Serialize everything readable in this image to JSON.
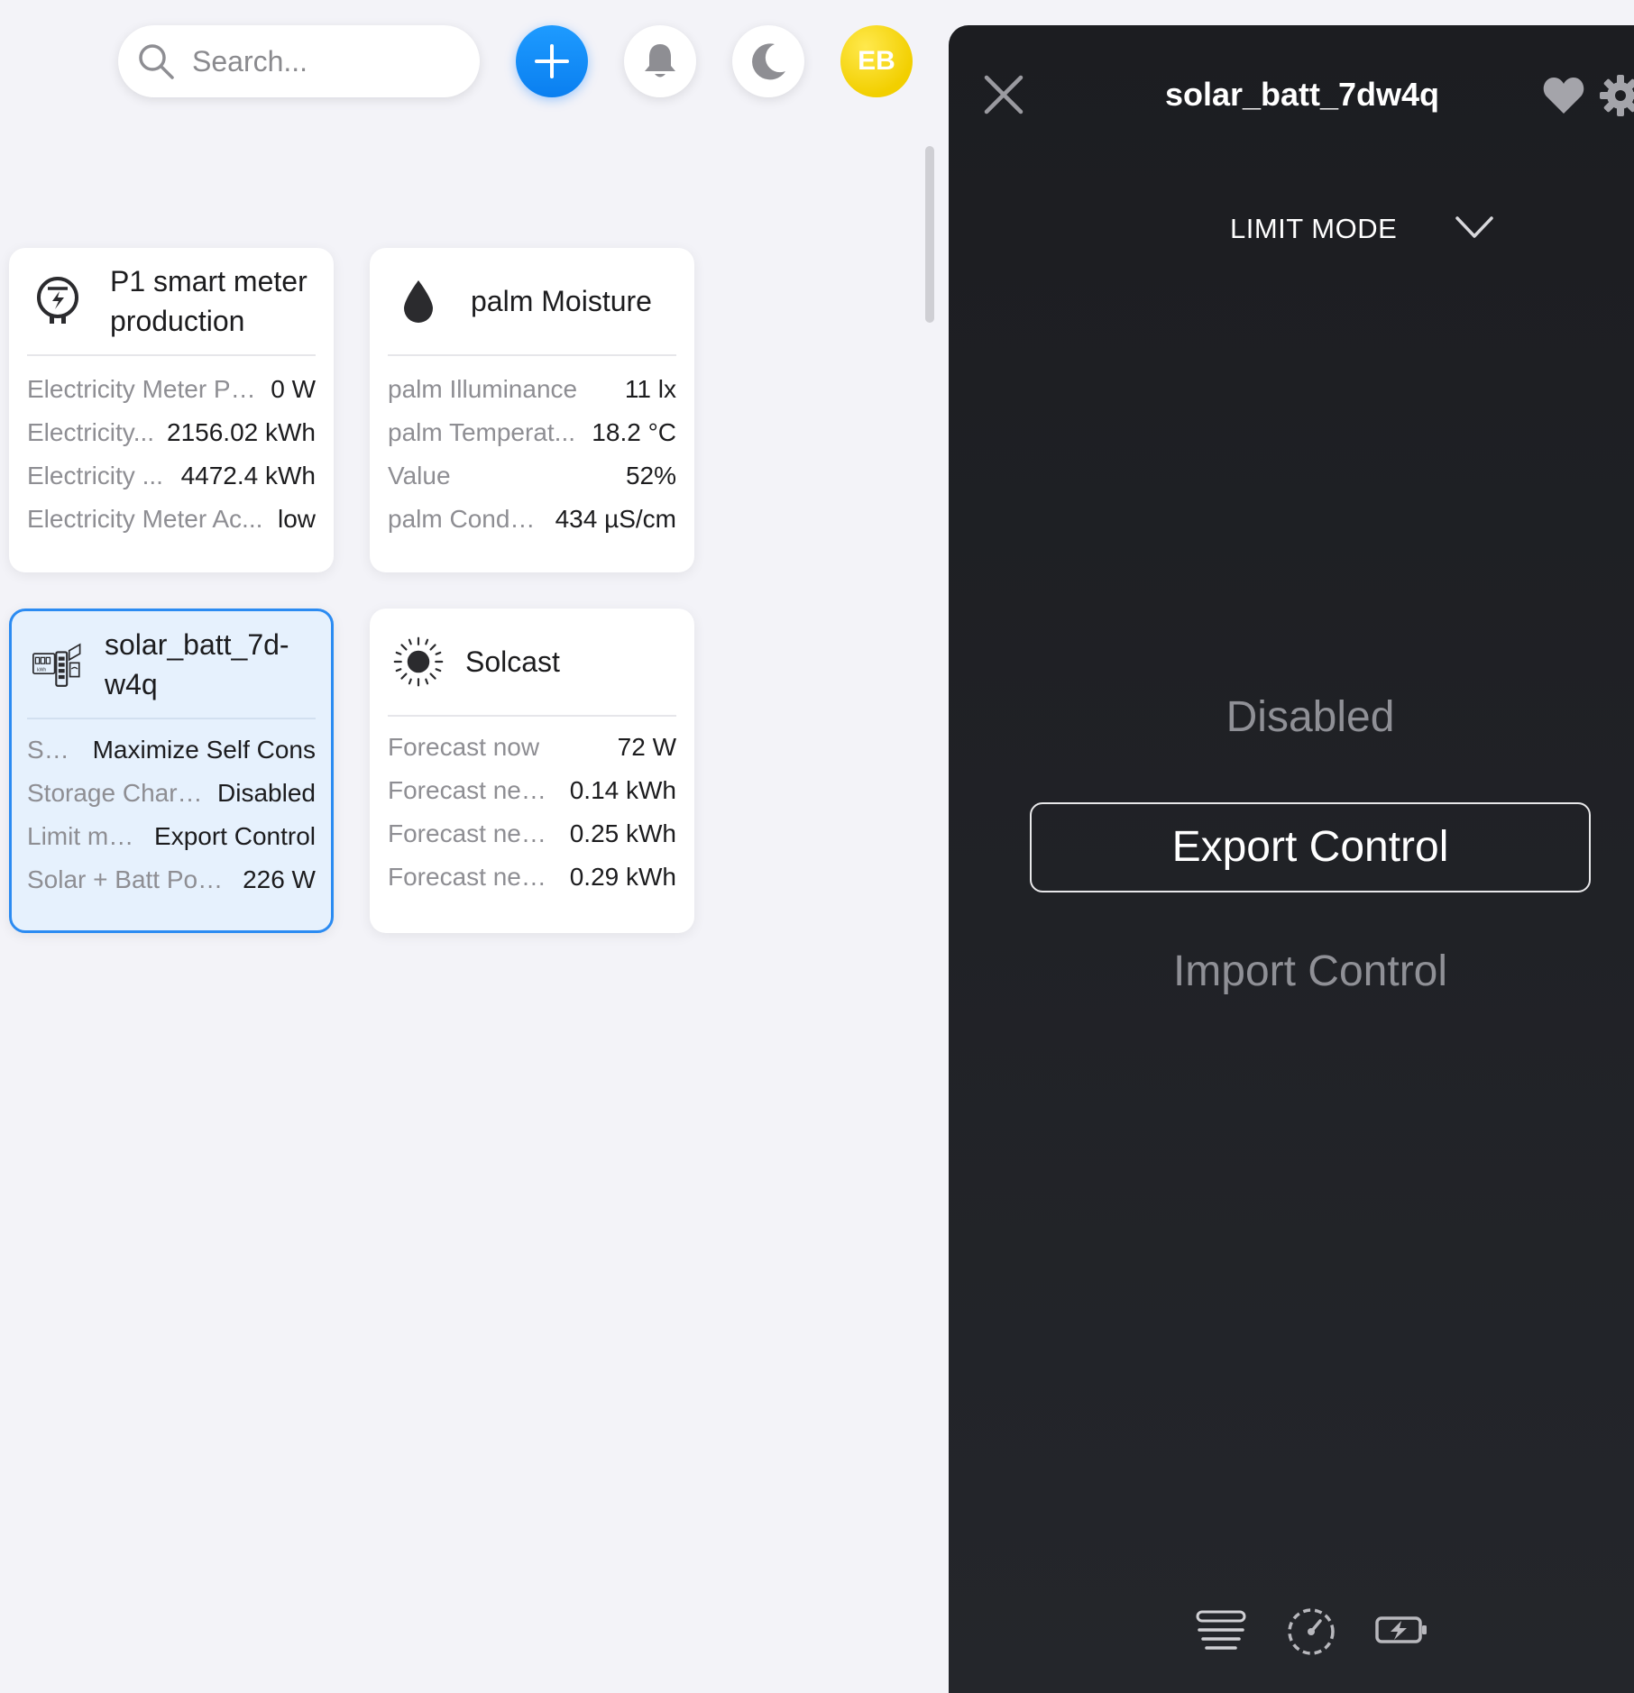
{
  "search": {
    "placeholder": "Search..."
  },
  "header": {
    "avatar_initials": "EB"
  },
  "colors": {
    "accent": "#0a84ff",
    "avatar": "#f2cf00",
    "panel_bg": "#1c1d21"
  },
  "cards": [
    {
      "title": "P1 smart meter production",
      "icon": "electricity-meter-icon",
      "rows": [
        {
          "label": "Electricity Meter Po...",
          "value": "0 W"
        },
        {
          "label": "Electricity...",
          "value": "2156.02 kWh"
        },
        {
          "label": "Electricity ...",
          "value": "4472.4 kWh"
        },
        {
          "label": "Electricity Meter Ac...",
          "value": "low"
        }
      ]
    },
    {
      "title": "palm Moisture",
      "icon": "water-drop-icon",
      "rows": [
        {
          "label": "palm Illuminance",
          "value": "11 lx"
        },
        {
          "label": "palm Temperat...",
          "value": "18.2 °C"
        },
        {
          "label": "Value",
          "value": "52%"
        },
        {
          "label": "palm Condu...",
          "value": "434 µS/cm"
        }
      ]
    },
    {
      "title_line1": "solar_batt_7d-",
      "title_line2": "w4q",
      "icon": "solar-battery-icon",
      "rows": [
        {
          "label": "Stor...",
          "value": "Maximize Self Cons"
        },
        {
          "label": "Storage Charg...",
          "value": "Disabled"
        },
        {
          "label": "Limit mo...",
          "value": "Export Control"
        },
        {
          "label": "Solar + Batt Power",
          "value": "226 W"
        }
      ]
    },
    {
      "title": "Solcast",
      "icon": "sun-icon",
      "rows": [
        {
          "label": "Forecast now",
          "value": "72 W"
        },
        {
          "label": "Forecast next...",
          "value": "0.14 kWh"
        },
        {
          "label": "Forecast next...",
          "value": "0.25 kWh"
        },
        {
          "label": "Forecast next...",
          "value": "0.29 kWh"
        }
      ]
    }
  ],
  "panel": {
    "title": "solar_batt_7dw4q",
    "mode_label": "LIMIT MODE",
    "options": [
      "Disabled",
      "Export Control",
      "Import Control"
    ],
    "selected_option": "Export Control"
  }
}
